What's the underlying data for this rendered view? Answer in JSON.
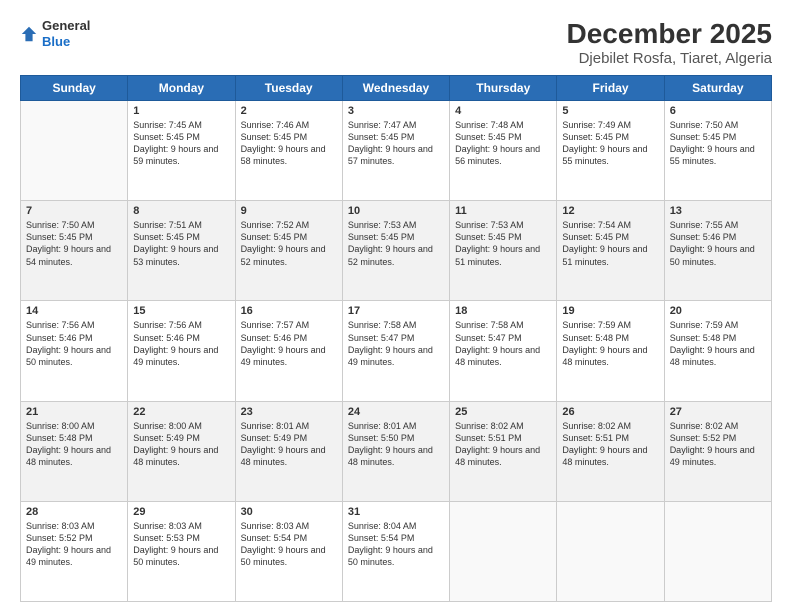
{
  "header": {
    "logo": {
      "general": "General",
      "blue": "Blue"
    },
    "title": "December 2025",
    "subtitle": "Djebilet Rosfa, Tiaret, Algeria"
  },
  "days_of_week": [
    "Sunday",
    "Monday",
    "Tuesday",
    "Wednesday",
    "Thursday",
    "Friday",
    "Saturday"
  ],
  "weeks": [
    [
      {
        "day": "",
        "info": ""
      },
      {
        "day": "1",
        "sunrise": "Sunrise: 7:45 AM",
        "sunset": "Sunset: 5:45 PM",
        "daylight": "Daylight: 9 hours and 59 minutes."
      },
      {
        "day": "2",
        "sunrise": "Sunrise: 7:46 AM",
        "sunset": "Sunset: 5:45 PM",
        "daylight": "Daylight: 9 hours and 58 minutes."
      },
      {
        "day": "3",
        "sunrise": "Sunrise: 7:47 AM",
        "sunset": "Sunset: 5:45 PM",
        "daylight": "Daylight: 9 hours and 57 minutes."
      },
      {
        "day": "4",
        "sunrise": "Sunrise: 7:48 AM",
        "sunset": "Sunset: 5:45 PM",
        "daylight": "Daylight: 9 hours and 56 minutes."
      },
      {
        "day": "5",
        "sunrise": "Sunrise: 7:49 AM",
        "sunset": "Sunset: 5:45 PM",
        "daylight": "Daylight: 9 hours and 55 minutes."
      },
      {
        "day": "6",
        "sunrise": "Sunrise: 7:50 AM",
        "sunset": "Sunset: 5:45 PM",
        "daylight": "Daylight: 9 hours and 55 minutes."
      }
    ],
    [
      {
        "day": "7",
        "sunrise": "Sunrise: 7:50 AM",
        "sunset": "Sunset: 5:45 PM",
        "daylight": "Daylight: 9 hours and 54 minutes."
      },
      {
        "day": "8",
        "sunrise": "Sunrise: 7:51 AM",
        "sunset": "Sunset: 5:45 PM",
        "daylight": "Daylight: 9 hours and 53 minutes."
      },
      {
        "day": "9",
        "sunrise": "Sunrise: 7:52 AM",
        "sunset": "Sunset: 5:45 PM",
        "daylight": "Daylight: 9 hours and 52 minutes."
      },
      {
        "day": "10",
        "sunrise": "Sunrise: 7:53 AM",
        "sunset": "Sunset: 5:45 PM",
        "daylight": "Daylight: 9 hours and 52 minutes."
      },
      {
        "day": "11",
        "sunrise": "Sunrise: 7:53 AM",
        "sunset": "Sunset: 5:45 PM",
        "daylight": "Daylight: 9 hours and 51 minutes."
      },
      {
        "day": "12",
        "sunrise": "Sunrise: 7:54 AM",
        "sunset": "Sunset: 5:45 PM",
        "daylight": "Daylight: 9 hours and 51 minutes."
      },
      {
        "day": "13",
        "sunrise": "Sunrise: 7:55 AM",
        "sunset": "Sunset: 5:46 PM",
        "daylight": "Daylight: 9 hours and 50 minutes."
      }
    ],
    [
      {
        "day": "14",
        "sunrise": "Sunrise: 7:56 AM",
        "sunset": "Sunset: 5:46 PM",
        "daylight": "Daylight: 9 hours and 50 minutes."
      },
      {
        "day": "15",
        "sunrise": "Sunrise: 7:56 AM",
        "sunset": "Sunset: 5:46 PM",
        "daylight": "Daylight: 9 hours and 49 minutes."
      },
      {
        "day": "16",
        "sunrise": "Sunrise: 7:57 AM",
        "sunset": "Sunset: 5:46 PM",
        "daylight": "Daylight: 9 hours and 49 minutes."
      },
      {
        "day": "17",
        "sunrise": "Sunrise: 7:58 AM",
        "sunset": "Sunset: 5:47 PM",
        "daylight": "Daylight: 9 hours and 49 minutes."
      },
      {
        "day": "18",
        "sunrise": "Sunrise: 7:58 AM",
        "sunset": "Sunset: 5:47 PM",
        "daylight": "Daylight: 9 hours and 48 minutes."
      },
      {
        "day": "19",
        "sunrise": "Sunrise: 7:59 AM",
        "sunset": "Sunset: 5:48 PM",
        "daylight": "Daylight: 9 hours and 48 minutes."
      },
      {
        "day": "20",
        "sunrise": "Sunrise: 7:59 AM",
        "sunset": "Sunset: 5:48 PM",
        "daylight": "Daylight: 9 hours and 48 minutes."
      }
    ],
    [
      {
        "day": "21",
        "sunrise": "Sunrise: 8:00 AM",
        "sunset": "Sunset: 5:48 PM",
        "daylight": "Daylight: 9 hours and 48 minutes."
      },
      {
        "day": "22",
        "sunrise": "Sunrise: 8:00 AM",
        "sunset": "Sunset: 5:49 PM",
        "daylight": "Daylight: 9 hours and 48 minutes."
      },
      {
        "day": "23",
        "sunrise": "Sunrise: 8:01 AM",
        "sunset": "Sunset: 5:49 PM",
        "daylight": "Daylight: 9 hours and 48 minutes."
      },
      {
        "day": "24",
        "sunrise": "Sunrise: 8:01 AM",
        "sunset": "Sunset: 5:50 PM",
        "daylight": "Daylight: 9 hours and 48 minutes."
      },
      {
        "day": "25",
        "sunrise": "Sunrise: 8:02 AM",
        "sunset": "Sunset: 5:51 PM",
        "daylight": "Daylight: 9 hours and 48 minutes."
      },
      {
        "day": "26",
        "sunrise": "Sunrise: 8:02 AM",
        "sunset": "Sunset: 5:51 PM",
        "daylight": "Daylight: 9 hours and 48 minutes."
      },
      {
        "day": "27",
        "sunrise": "Sunrise: 8:02 AM",
        "sunset": "Sunset: 5:52 PM",
        "daylight": "Daylight: 9 hours and 49 minutes."
      }
    ],
    [
      {
        "day": "28",
        "sunrise": "Sunrise: 8:03 AM",
        "sunset": "Sunset: 5:52 PM",
        "daylight": "Daylight: 9 hours and 49 minutes."
      },
      {
        "day": "29",
        "sunrise": "Sunrise: 8:03 AM",
        "sunset": "Sunset: 5:53 PM",
        "daylight": "Daylight: 9 hours and 50 minutes."
      },
      {
        "day": "30",
        "sunrise": "Sunrise: 8:03 AM",
        "sunset": "Sunset: 5:54 PM",
        "daylight": "Daylight: 9 hours and 50 minutes."
      },
      {
        "day": "31",
        "sunrise": "Sunrise: 8:04 AM",
        "sunset": "Sunset: 5:54 PM",
        "daylight": "Daylight: 9 hours and 50 minutes."
      },
      {
        "day": "",
        "info": ""
      },
      {
        "day": "",
        "info": ""
      },
      {
        "day": "",
        "info": ""
      }
    ]
  ]
}
